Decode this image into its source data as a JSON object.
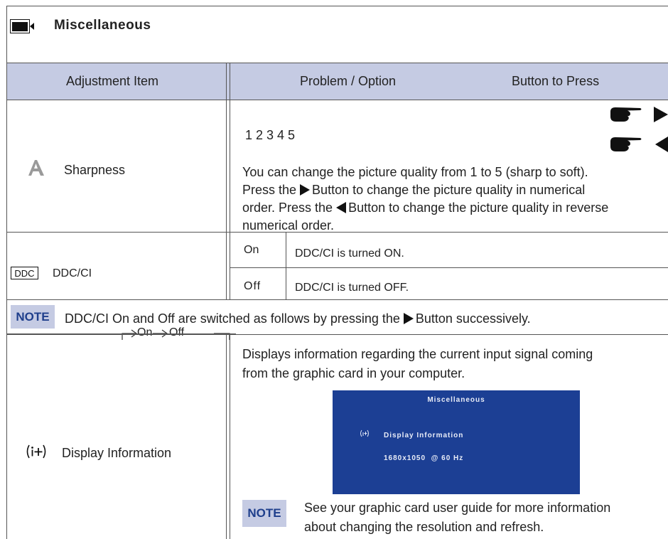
{
  "section": {
    "title": "Miscellaneous",
    "icon": "monitor-menu-icon"
  },
  "table_header": {
    "adjustment_item": "Adjustment Item",
    "problem_option": "Problem / Option",
    "button_to_press": "Button to Press"
  },
  "sharpness": {
    "label": "Sharpness",
    "icon": "sharpness-a-icon",
    "values": "1 2 3 4 5",
    "line1": "You can change the picture quality from 1 to 5 (sharp to soft).",
    "line2_pre": "Press the",
    "line2_post": "Button to change the picture quality in numerical",
    "line3_pre": "order. Press the",
    "line3_post": "Button to change the picture quality in reverse",
    "line4": "numerical order."
  },
  "ddcci": {
    "label": "DDC/CI",
    "icon_text": "DDC",
    "rows": [
      {
        "option": "On",
        "desc": "DDC/CI is turned ON."
      },
      {
        "option": "Off",
        "desc": "DDC/CI is turned OFF."
      }
    ]
  },
  "note1": {
    "badge": "NOTE",
    "text_pre": "DDC/CI On and Off are switched as follows by pressing the",
    "text_post": "Button successively.",
    "cycle_on": "On",
    "cycle_off": "Off"
  },
  "display_info": {
    "label": "Display Information",
    "icon_text": "i+",
    "desc_line1": "Displays information regarding the current input signal coming",
    "desc_line2": "from the graphic card in your computer.",
    "osd": {
      "title": "Miscellaneous",
      "item": "Display Information",
      "resolution": "1680x1050  @ 60 Hz"
    },
    "note_badge": "NOTE",
    "note_line1": "See your graphic card user guide for more information",
    "note_line2": "about changing the resolution and refresh."
  },
  "colors": {
    "header_bg": "#c5cbe3",
    "osd_bg": "#1c3f94",
    "note_text": "#1f3f8c"
  }
}
